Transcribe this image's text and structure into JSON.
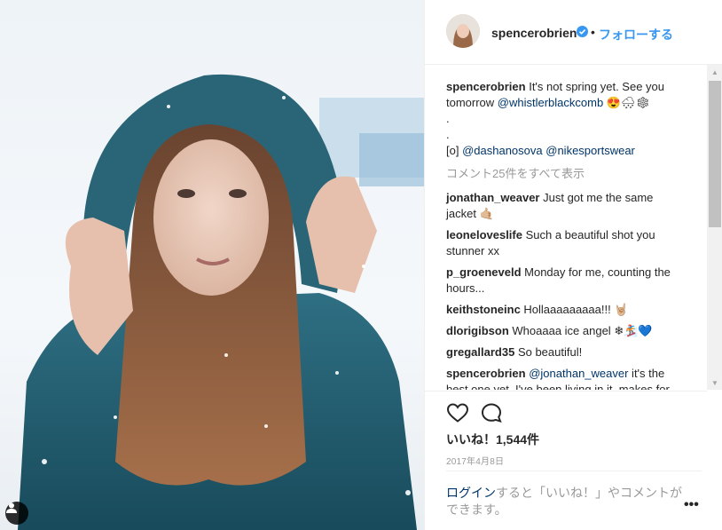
{
  "post": {
    "username": "spencerobrien",
    "follow_label": "フォローする",
    "separator": "•",
    "caption_user": "spencerobrien",
    "caption_line1": " It's not spring yet. See you tomorrow ",
    "caption_mention1": "@whistlerblackcomb",
    "caption_emoji": " 😍🌨❄",
    "caption_dot1": ".",
    "caption_dot2": ".",
    "caption_credit_prefix": "[o] ",
    "caption_mention2": "@dashanosova",
    "caption_mention3": "@nikesportswear",
    "view_all_comments": "コメント25件をすべて表示",
    "comments": [
      {
        "user": "jonathan_weaver",
        "text": " Just got me the same jacket ",
        "emoji": "🤙🏼"
      },
      {
        "user": "leoneloveslife",
        "text": " Such a beautiful shot you stunner xx",
        "emoji": ""
      },
      {
        "user": "p_groeneveld",
        "text": " Monday for me, counting the hours...",
        "emoji": ""
      },
      {
        "user": "keithstoneinc",
        "text": " Hollaaaaaaaaa!!! ",
        "emoji": "🤘🏼"
      },
      {
        "user": "dlorigibson",
        "text": " Whoaaaa ice angel ",
        "emoji": "❄🏂💙"
      },
      {
        "user": "gregallard35",
        "text": " So beautiful!",
        "emoji": ""
      },
      {
        "user": "spencerobrien",
        "mention": "@jonathan_weaver",
        "text": " it's the best one yet. I've been living in it, makes for"
      }
    ],
    "likes": "いいね！1,544件",
    "date": "2017年4月8日",
    "login_link": "ログイン",
    "login_text": "すると「いいね！」やコメントができます。",
    "more_options": "•••"
  },
  "icons": {
    "verified": "verified-badge-icon",
    "like": "heart-icon",
    "comment": "comment-icon",
    "user_tag": "user-tag-icon",
    "more": "more-options-icon"
  },
  "colors": {
    "link": "#003569",
    "follow": "#3897f0",
    "muted": "#999999",
    "text": "#262626"
  }
}
